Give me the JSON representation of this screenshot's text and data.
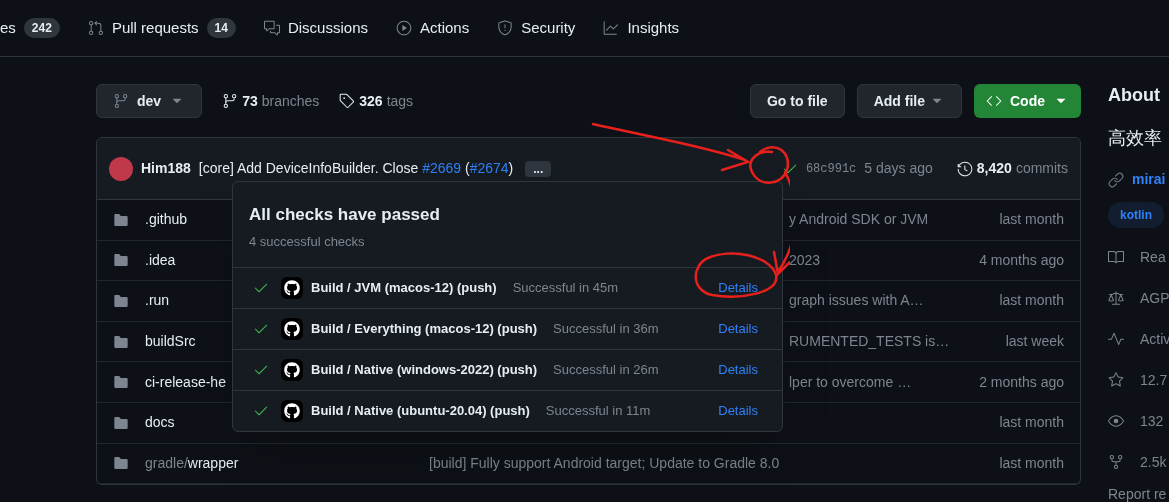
{
  "nav": [
    {
      "label": "es",
      "count": "242"
    },
    {
      "label": "Pull requests",
      "count": "14"
    },
    {
      "label": "Discussions"
    },
    {
      "label": "Actions"
    },
    {
      "label": "Security"
    },
    {
      "label": "Insights"
    }
  ],
  "toolbar": {
    "branch": "dev",
    "branches_count": "73",
    "branches_label": "branches",
    "tags_count": "326",
    "tags_label": "tags",
    "go_to_file": "Go to file",
    "add_file": "Add file",
    "code": "Code"
  },
  "commit": {
    "author": "Him188",
    "message": [
      {
        "kind": "text",
        "text": "[core] Add DeviceInfoBuilder. Close "
      },
      {
        "kind": "link",
        "text": "#2669"
      },
      {
        "kind": "text",
        "text": " ("
      },
      {
        "kind": "link",
        "text": "#2674"
      },
      {
        "kind": "text",
        "text": ")"
      }
    ],
    "more": "...",
    "hash": "68c991c",
    "time": "5 days ago",
    "commits_count": "8,420",
    "commits_label": "commits"
  },
  "files": [
    {
      "name": ".github",
      "message": "y Android SDK or JVM",
      "covered": true,
      "date": "last month"
    },
    {
      "name": ".idea",
      "message": "2023",
      "covered": true,
      "date": "4 months ago"
    },
    {
      "name": ".run",
      "message": "graph issues with A…",
      "covered": true,
      "date": "last month"
    },
    {
      "name": "buildSrc",
      "message": "RUMENTED_TESTS is…",
      "covered": true,
      "date": "last week"
    },
    {
      "name": "ci-release-he",
      "message": "lper to overcome …",
      "covered": true,
      "date": "2 months ago"
    },
    {
      "name": "docs",
      "date": "last month"
    },
    {
      "prefix": "gradle/",
      "name": "wrapper",
      "message": "[build] Fully support Android target; Update to Gradle 8.0",
      "covered": false,
      "date": "last month"
    }
  ],
  "checks_popup": {
    "title": "All checks have passed",
    "subtitle": "4 successful checks",
    "checks": [
      {
        "name": "Build / JVM (macos-12) (push)",
        "duration": "Successful in 45m",
        "link": "Details"
      },
      {
        "name": "Build / Everything (macos-12) (push)",
        "duration": "Successful in 36m",
        "link": "Details"
      },
      {
        "name": "Build / Native (windows-2022) (push)",
        "duration": "Successful in 26m",
        "link": "Details"
      },
      {
        "name": "Build / Native (ubuntu-20.04) (push)",
        "duration": "Successful in 11m",
        "link": "Details"
      }
    ]
  },
  "about": {
    "title": "About",
    "description": "高效率",
    "link": "mirai",
    "topics": [
      "kotlin"
    ],
    "items": [
      {
        "text": "Rea"
      },
      {
        "text": "AGP"
      },
      {
        "text": "Activ"
      },
      {
        "text": "12.7"
      },
      {
        "text": "132"
      },
      {
        "text": "2.5k"
      }
    ],
    "report": "Report re"
  }
}
